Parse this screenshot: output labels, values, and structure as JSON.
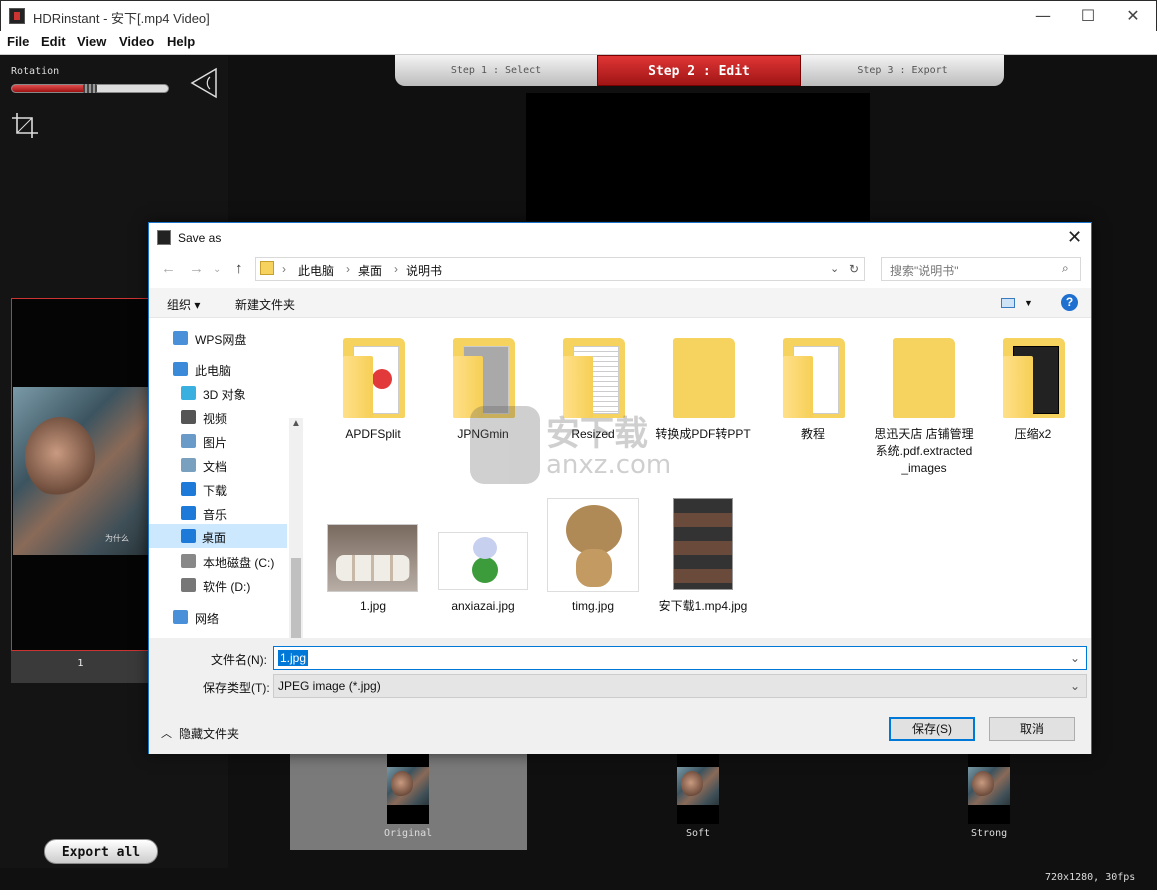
{
  "window": {
    "title": "HDRinstant  -  安下[.mp4 Video]"
  },
  "menu": [
    "File",
    "Edit",
    "View",
    "Video",
    "Help"
  ],
  "rotation": {
    "label": "Rotation",
    "value": 0.5
  },
  "steps": [
    "Step 1 : Select",
    "Step 2 : Edit",
    "Step 3 : Export"
  ],
  "thumb": {
    "number": "1",
    "caption": "为什么"
  },
  "export_all": "Export all",
  "previews": [
    "Original",
    "Soft",
    "Strong"
  ],
  "resolution": "720x1280, 30fps",
  "dialog": {
    "title": "Save as",
    "breadcrumb": [
      "此电脑",
      "桌面",
      "说明书"
    ],
    "search_placeholder": "搜索\"说明书\"",
    "organize": "组织 ▾",
    "new_folder": "新建文件夹",
    "nav": [
      {
        "label": "WPS网盘",
        "icon": "cloud-icon",
        "color": "#4a90d9"
      },
      {
        "label": "此电脑",
        "icon": "computer-icon",
        "color": "#3a8ad9"
      },
      {
        "label": "3D 对象",
        "icon": "cube-icon",
        "color": "#3ab0e0"
      },
      {
        "label": "视频",
        "icon": "video-icon",
        "color": "#555555"
      },
      {
        "label": "图片",
        "icon": "picture-icon",
        "color": "#6a9ac8"
      },
      {
        "label": "文档",
        "icon": "document-icon",
        "color": "#7aa0c0"
      },
      {
        "label": "下载",
        "icon": "download-icon",
        "color": "#1e7ad9"
      },
      {
        "label": "音乐",
        "icon": "music-icon",
        "color": "#1e7ad9"
      },
      {
        "label": "桌面",
        "icon": "desktop-icon",
        "color": "#1e7ad9"
      },
      {
        "label": "本地磁盘 (C:)",
        "icon": "disk-icon",
        "color": "#888888"
      },
      {
        "label": "软件 (D:)",
        "icon": "disk-icon",
        "color": "#777777"
      },
      {
        "label": "网络",
        "icon": "network-icon",
        "color": "#4a90d9"
      }
    ],
    "folders": [
      {
        "name": "APDFSplit"
      },
      {
        "name": "JPNGmin"
      },
      {
        "name": "Resized"
      },
      {
        "name": "转换成PDF转PPT"
      },
      {
        "name": "教程"
      },
      {
        "name": "思迅天店 店铺管理系统.pdf.extracted_images"
      },
      {
        "name": "压缩x2"
      }
    ],
    "images": [
      {
        "name": "1.jpg"
      },
      {
        "name": "anxiazai.jpg"
      },
      {
        "name": "timg.jpg"
      },
      {
        "name": "安下载1.mp4.jpg"
      }
    ],
    "filename_label": "文件名(N):",
    "filename": "1.jpg",
    "type_label": "保存类型(T):",
    "type": "JPEG image (*.jpg)",
    "hide_folders": "隐藏文件夹",
    "save": "保存(S)",
    "cancel": "取消"
  },
  "watermark": {
    "line1": "安下载",
    "line2": "anxz.com"
  }
}
